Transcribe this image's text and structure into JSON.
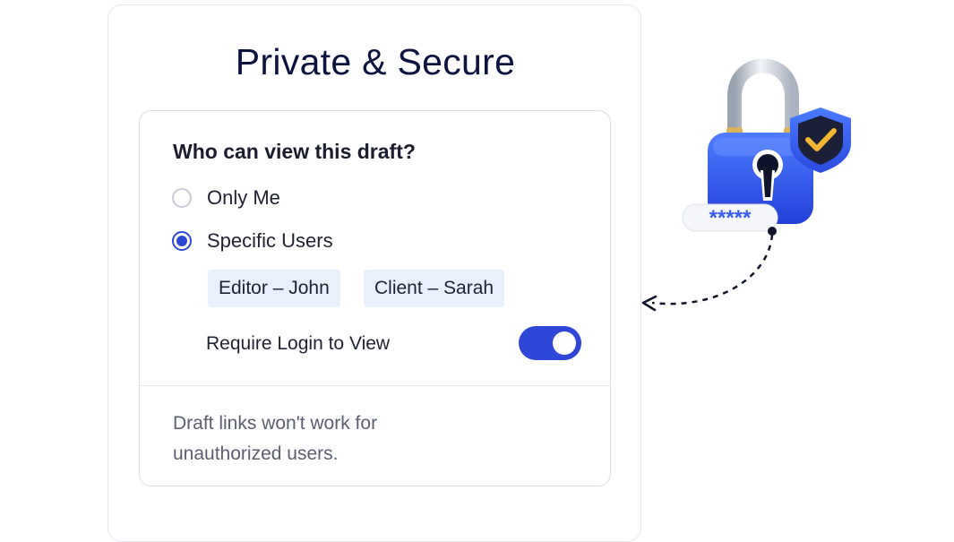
{
  "header": {
    "title": "Private & Secure"
  },
  "visibility": {
    "question": "Who can view this draft?",
    "options": [
      {
        "label": "Only Me",
        "selected": false
      },
      {
        "label": "Specific Users",
        "selected": true
      }
    ],
    "selected_users": [
      "Editor – John",
      "Client – Sarah"
    ],
    "require_login": {
      "label": "Require Login to View",
      "enabled": true
    }
  },
  "footer": {
    "note": "Draft links won't work for unauthorized users."
  },
  "illustration": {
    "icon": "padlock-shield-icon",
    "password_mask": "*****"
  },
  "colors": {
    "accent": "#2f47d6",
    "title": "#0c1340",
    "chip_bg": "#e8f0fb",
    "lock_body": "#2f5bea",
    "shield_check": "#f2b632"
  }
}
